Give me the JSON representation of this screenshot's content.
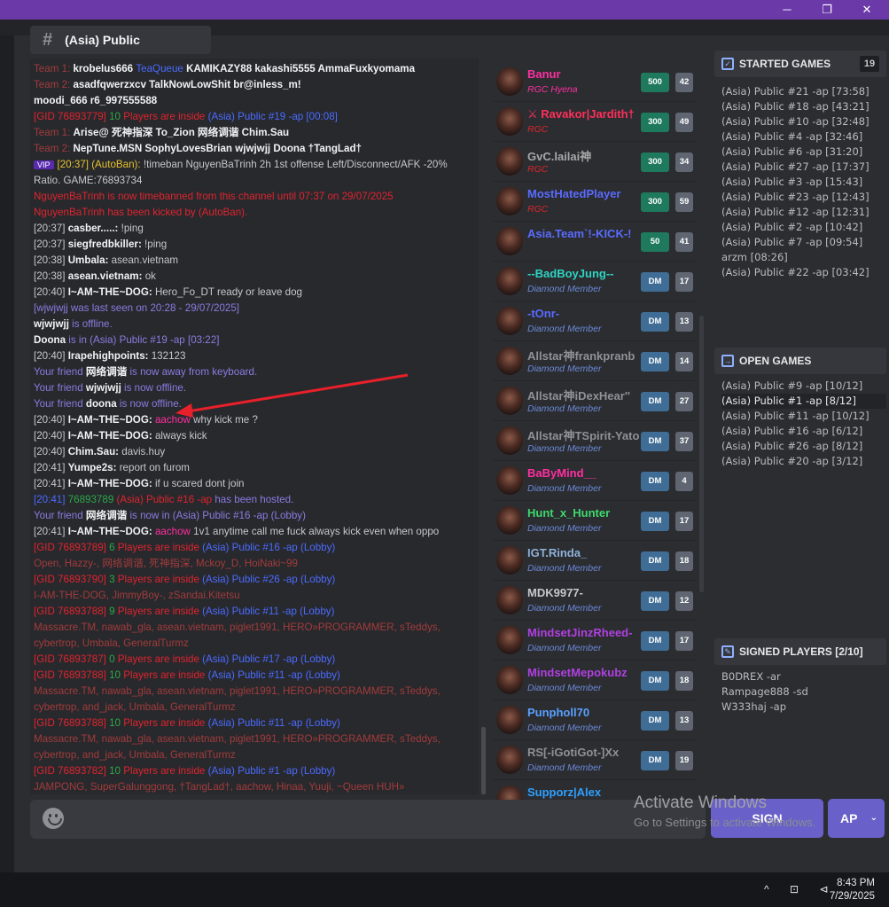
{
  "window": {
    "min": "─",
    "restore": "❐",
    "close": "✕"
  },
  "channel": {
    "hash": "#",
    "name": "(Asia) Public"
  },
  "chat": [
    [
      [
        "Team 1: ",
        "dred"
      ],
      [
        "krobelus666  ",
        "b"
      ],
      [
        "TeaQueue  ",
        "blue"
      ],
      [
        "KAMIKAZY88  kakashi5555  AmmaFuxkyomama",
        "b"
      ]
    ],
    [
      [
        "Team 2: ",
        "dred"
      ],
      [
        "asadfqwerzxcv  TalkNowLowShit  br@inless_m!",
        "b"
      ]
    ],
    [
      [
        "moodi_666  r6_997555588",
        "b"
      ]
    ],
    [
      [
        "[GID 76893779] ",
        "red"
      ],
      [
        "10 ",
        "grn"
      ],
      [
        "Players are inside ",
        "red"
      ],
      [
        "(Asia) Public #19 -ap [00:08]",
        "blue"
      ]
    ],
    [
      [
        "Team 1: ",
        "dred"
      ],
      [
        "Arise@  死神指深  To_Zion  网络调谐  Chim.Sau",
        "b"
      ]
    ],
    [
      [
        "Team 2: ",
        "dred"
      ],
      [
        "NepTune.MSN  SophyLovesBrian  wjwjwjj  Doona  †TangLad†",
        "b"
      ]
    ],
    [
      [
        "VIP",
        "vip"
      ],
      [
        "[20:37] (AutoBan): ",
        "yel"
      ],
      [
        "!timeban NguyenBaTrinh 2h 1st offense Left/Disconnect/AFK -20%",
        "gray"
      ]
    ],
    [
      [
        "Ratio. GAME:76893734",
        "gray"
      ]
    ],
    [
      [
        "NguyenBaTrinh is now timebanned from this channel until 07:37 on 29/07/2025",
        "red"
      ]
    ],
    [
      [
        "NguyenBaTrinh has been kicked by (AutoBan).",
        "red"
      ]
    ],
    [
      [
        "[20:37] ",
        "gray"
      ],
      [
        "casber.....: ",
        "b"
      ],
      [
        "!ping",
        "gray"
      ]
    ],
    [
      [
        "[20:37] ",
        "gray"
      ],
      [
        "siegfredbkiller: ",
        "b"
      ],
      [
        "!ping",
        "gray"
      ]
    ],
    [
      [
        "[20:38] ",
        "gray"
      ],
      [
        "Umbala: ",
        "b"
      ],
      [
        "asean.vietnam",
        "gray"
      ]
    ],
    [
      [
        "[20:38] ",
        "gray"
      ],
      [
        "asean.vietnam: ",
        "b"
      ],
      [
        "ok",
        "gray"
      ]
    ],
    [
      [
        "[20:40] ",
        "gray"
      ],
      [
        "I~AM~THE~DOG: ",
        "b"
      ],
      [
        "Hero_Fo_DT ready or leave dog",
        "gray"
      ]
    ],
    [
      [
        "[wjwjwjj was last seen on 20:28 - 29/07/2025]",
        "purp"
      ]
    ],
    [
      [
        "wjwjwjj ",
        "b"
      ],
      [
        "is offline.",
        "purp"
      ]
    ],
    [
      [
        "Doona ",
        "b"
      ],
      [
        "is in (Asia) Public #19 -ap [03:22]",
        "purp"
      ]
    ],
    [
      [
        "[20:40] ",
        "gray"
      ],
      [
        "Irapehighpoints: ",
        "b"
      ],
      [
        "132123",
        "gray"
      ]
    ],
    [
      [
        "Your friend ",
        "purp"
      ],
      [
        "网络调谐 ",
        "b"
      ],
      [
        "is now away from keyboard.",
        "purp"
      ]
    ],
    [
      [
        "Your friend ",
        "purp"
      ],
      [
        "wjwjwjj ",
        "b"
      ],
      [
        "is now offline.",
        "purp"
      ]
    ],
    [
      [
        "Your friend ",
        "purp"
      ],
      [
        "doona ",
        "b"
      ],
      [
        "is now offline.",
        "purp"
      ]
    ],
    [
      [
        "[20:40] ",
        "gray"
      ],
      [
        "I~AM~THE~DOG: ",
        "b"
      ],
      [
        "aachow ",
        "mag"
      ],
      [
        "why kick me ?",
        "gray"
      ]
    ],
    [
      [
        "[20:40] ",
        "gray"
      ],
      [
        "I~AM~THE~DOG: ",
        "b"
      ],
      [
        "always kick",
        "gray"
      ]
    ],
    [
      [
        "[20:40] ",
        "gray"
      ],
      [
        "Chim.Sau: ",
        "b"
      ],
      [
        "davis.huy",
        "gray"
      ]
    ],
    [
      [
        "[20:41] ",
        "gray"
      ],
      [
        "Yumpe2s: ",
        "b"
      ],
      [
        "report on furom",
        "gray"
      ]
    ],
    [
      [
        "[20:41] ",
        "gray"
      ],
      [
        "I~AM~THE~DOG: ",
        "b"
      ],
      [
        "if u scared dont join",
        "gray"
      ]
    ],
    [
      [
        "[20:41] ",
        "blue"
      ],
      [
        "76893789 ",
        "grn"
      ],
      [
        "(Asia) Public #16 -ap ",
        "red"
      ],
      [
        "has been hosted.",
        "purp"
      ]
    ],
    [
      [
        "Your friend ",
        "purp"
      ],
      [
        "网络调谐 ",
        "b"
      ],
      [
        "is now in (Asia) Public #16 -ap (Lobby)",
        "purp"
      ]
    ],
    [
      [
        "[20:41] ",
        "gray"
      ],
      [
        "I~AM~THE~DOG: ",
        "b"
      ],
      [
        "aachow ",
        "mag"
      ],
      [
        "1v1 anytime call me fuck always kick even when oppo",
        "gray"
      ]
    ],
    [
      [
        "[GID 76893789] ",
        "red"
      ],
      [
        "6 ",
        "grn"
      ],
      [
        "Players are inside ",
        "red"
      ],
      [
        "(Asia) Public #16 -ap (Lobby)",
        "blue"
      ]
    ],
    [
      [
        "Open, Hazzy-, 网络调谐, 死神指深, Mckoy_D, HoiNaki~99",
        "dred"
      ]
    ],
    [
      [
        "[GID 76893790] ",
        "red"
      ],
      [
        "3 ",
        "grn"
      ],
      [
        "Players are inside ",
        "red"
      ],
      [
        "(Asia) Public #26 -ap (Lobby)",
        "blue"
      ]
    ],
    [
      [
        "I-AM-THE-DOG, JimmyBoy-, zSandai.Kitetsu",
        "dred"
      ]
    ],
    [
      [
        "[GID 76893788] ",
        "red"
      ],
      [
        "9 ",
        "grn"
      ],
      [
        "Players are inside ",
        "red"
      ],
      [
        "(Asia) Public #11 -ap (Lobby)",
        "blue"
      ]
    ],
    [
      [
        "Massacre.TM, nawab_gla, asean.vietnam, piglet1991, HERO»PROGRAMMER, sTeddys,",
        "dred"
      ]
    ],
    [
      [
        "cybertrop, Umbala, GeneralTurmz",
        "dred"
      ]
    ],
    [
      [
        "[GID 76893787] ",
        "red"
      ],
      [
        "0 ",
        "grn"
      ],
      [
        "Players are inside ",
        "red"
      ],
      [
        "(Asia) Public #17 -ap (Lobby)",
        "blue"
      ]
    ],
    [
      [
        "[GID 76893788] ",
        "red"
      ],
      [
        "10 ",
        "grn"
      ],
      [
        "Players are inside ",
        "red"
      ],
      [
        "(Asia) Public #11 -ap (Lobby)",
        "blue"
      ]
    ],
    [
      [
        "Massacre.TM, nawab_gla, asean.vietnam, piglet1991, HERO»PROGRAMMER, sTeddys,",
        "dred"
      ]
    ],
    [
      [
        "cybertrop, and_jack, Umbala, GeneralTurmz",
        "dred"
      ]
    ],
    [
      [
        "[GID 76893788] ",
        "red"
      ],
      [
        "10 ",
        "grn"
      ],
      [
        "Players are inside ",
        "red"
      ],
      [
        "(Asia) Public #11 -ap (Lobby)",
        "blue"
      ]
    ],
    [
      [
        "Massacre.TM, nawab_gla, asean.vietnam, piglet1991, HERO»PROGRAMMER, sTeddys,",
        "dred"
      ]
    ],
    [
      [
        "cybertrop, and_jack, Umbala, GeneralTurmz",
        "dred"
      ]
    ],
    [
      [
        "[GID 76893782] ",
        "red"
      ],
      [
        "10 ",
        "grn"
      ],
      [
        "Players are inside ",
        "red"
      ],
      [
        "(Asia) Public #1 -ap (Lobby)",
        "blue"
      ]
    ],
    [
      [
        "JAMPONG, SuperGalunggong, †TangLad†, aachow, Hinaa, Yuuji, ~Queen HUH»",
        "dred"
      ]
    ]
  ],
  "players": [
    {
      "name": "Banur",
      "nameColor": "#ff2fa0",
      "sub": "RGC Hyena",
      "subColor": "#ff2fa0",
      "badge": "500",
      "level": "42"
    },
    {
      "name": "⚔ Ravakor|Jardith†",
      "nameColor": "#ff2f5a",
      "sub": "RGC",
      "subColor": "#e0242e",
      "badge": "300",
      "level": "49"
    },
    {
      "name": "GvC.lailai神",
      "nameColor": "#a8a8a8",
      "sub": "RGC",
      "subColor": "#e0242e",
      "badge": "300",
      "level": "34"
    },
    {
      "name": "MostHatedPlayer",
      "nameColor": "#5a6bff",
      "sub": "RGC",
      "subColor": "#e0242e",
      "badge": "300",
      "level": "59"
    },
    {
      "name": "Asia.Team`!-KICK-!",
      "nameColor": "#5a6bff",
      "sub": "",
      "subColor": "#8c7be0",
      "badge": "50",
      "level": "41"
    },
    {
      "name": "--BadBoyJung--",
      "nameColor": "#2fd4c2",
      "sub": "Diamond Member",
      "subColor": "#6c8ad8",
      "badge": "DM",
      "level": "17"
    },
    {
      "name": "-tOnr-",
      "nameColor": "#5a6bff",
      "sub": "Diamond Member",
      "subColor": "#6c8ad8",
      "badge": "DM",
      "level": "13"
    },
    {
      "name": "Allstar神frankpranb",
      "nameColor": "#8e9297",
      "sub": "Diamond Member",
      "subColor": "#6c8ad8",
      "badge": "DM",
      "level": "14"
    },
    {
      "name": "Allstar神iDexHear''",
      "nameColor": "#8e9297",
      "sub": "Diamond Member",
      "subColor": "#6c8ad8",
      "badge": "DM",
      "level": "27"
    },
    {
      "name": "Allstar神TSpirit-Yato",
      "nameColor": "#8e9297",
      "sub": "Diamond Member",
      "subColor": "#6c8ad8",
      "badge": "DM",
      "level": "37"
    },
    {
      "name": "BaByMind__",
      "nameColor": "#ff2fa0",
      "sub": "Diamond Member",
      "subColor": "#6c8ad8",
      "badge": "DM",
      "level": "4"
    },
    {
      "name": "Hunt_x_Hunter",
      "nameColor": "#3fd96b",
      "sub": "Diamond Member",
      "subColor": "#6c8ad8",
      "badge": "DM",
      "level": "17"
    },
    {
      "name": "IGT.Rinda_",
      "nameColor": "#8fb1d8",
      "sub": "Diamond Member",
      "subColor": "#6c8ad8",
      "badge": "DM",
      "level": "18"
    },
    {
      "name": "MDK9977-",
      "nameColor": "#c5c8cc",
      "sub": "Diamond Member",
      "subColor": "#6c8ad8",
      "badge": "DM",
      "level": "12"
    },
    {
      "name": "MindsetJinzRheed-",
      "nameColor": "#b040e0",
      "sub": "Diamond Member",
      "subColor": "#6c8ad8",
      "badge": "DM",
      "level": "17"
    },
    {
      "name": "MindsetMepokubz",
      "nameColor": "#b040e0",
      "sub": "Diamond Member",
      "subColor": "#6c8ad8",
      "badge": "DM",
      "level": "18"
    },
    {
      "name": "Punpholl70",
      "nameColor": "#5aa0ff",
      "sub": "Diamond Member",
      "subColor": "#6c8ad8",
      "badge": "DM",
      "level": "13"
    },
    {
      "name": "RS[-iGotiGot-]Xx",
      "nameColor": "#8e9297",
      "sub": "Diamond Member",
      "subColor": "#6c8ad8",
      "badge": "DM",
      "level": "19"
    },
    {
      "name": "Supporz|Alex",
      "nameColor": "#2fa0ff",
      "sub": "",
      "subColor": "#6c8ad8",
      "badge": "",
      "level": ""
    }
  ],
  "started": {
    "title": "STARTED GAMES",
    "count": "19",
    "items": [
      "(Asia) Public #21 -ap [73:58]",
      "(Asia) Public #18 -ap [43:21]",
      "(Asia) Public #10 -ap [32:48]",
      "(Asia) Public #4 -ap [32:46]",
      "(Asia) Public #6 -ap [31:20]",
      "(Asia) Public #27 -ap [17:37]",
      "(Asia) Public #3 -ap [15:43]",
      "(Asia) Public #23 -ap [12:43]",
      "(Asia) Public #12 -ap [12:31]",
      "(Asia) Public #2 -ap [10:42]",
      "(Asia) Public #7 -ap [09:54]",
      "arzm [08:26]",
      "(Asia) Public #22 -ap [03:42]"
    ]
  },
  "open": {
    "title": "OPEN GAMES",
    "items": [
      "(Asia) Public #9 -ap [10/12]",
      "(Asia) Public #1 -ap [8/12]",
      "(Asia) Public #11 -ap [10/12]",
      "(Asia) Public #16 -ap [6/12]",
      "(Asia) Public #26 -ap [8/12]",
      "(Asia) Public #20 -ap [3/12]"
    ],
    "selected": 1
  },
  "signed": {
    "title": "SIGNED PLAYERS [2/10]",
    "items": [
      "B0DREX -ar",
      "Rampage888 -sd",
      "W333haj -ap"
    ]
  },
  "buttons": {
    "sign": "SIGN",
    "ap": "AP",
    "ap_chevron": "⌄"
  },
  "watermark": {
    "line1": "Activate Windows",
    "line2": "Go to Settings to activate Windows."
  },
  "taskbar": {
    "time": "8:43 PM",
    "date": "7/29/2025",
    "tray": "^ ⊡ ⊲"
  }
}
